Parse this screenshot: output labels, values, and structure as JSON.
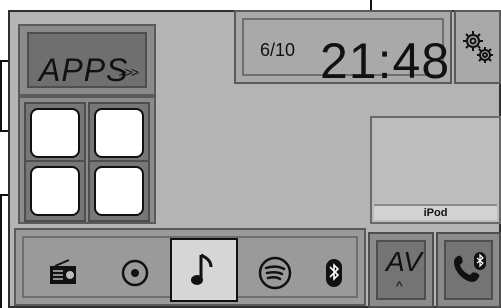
{
  "home": {
    "apps_label": "APPS",
    "apps_chevrons": ">>>",
    "clock": {
      "date": "6/10",
      "time": "21:48"
    },
    "now_playing_source": "iPod",
    "av_label": "AV",
    "av_caret": "^"
  },
  "source_bar": {
    "items": [
      {
        "icon": "radio-icon"
      },
      {
        "icon": "disc-icon"
      },
      {
        "icon": "music-note-icon",
        "selected": true
      },
      {
        "icon": "spotify-icon"
      },
      {
        "icon": "bluetooth-icon"
      }
    ]
  },
  "icons": {
    "settings": "settings-gears-icon",
    "phone": "phone-bluetooth-icon"
  },
  "colors": {
    "screen_bg": "#b4b4b4",
    "button_bg": "#8b8b8b",
    "text": "#111111"
  }
}
